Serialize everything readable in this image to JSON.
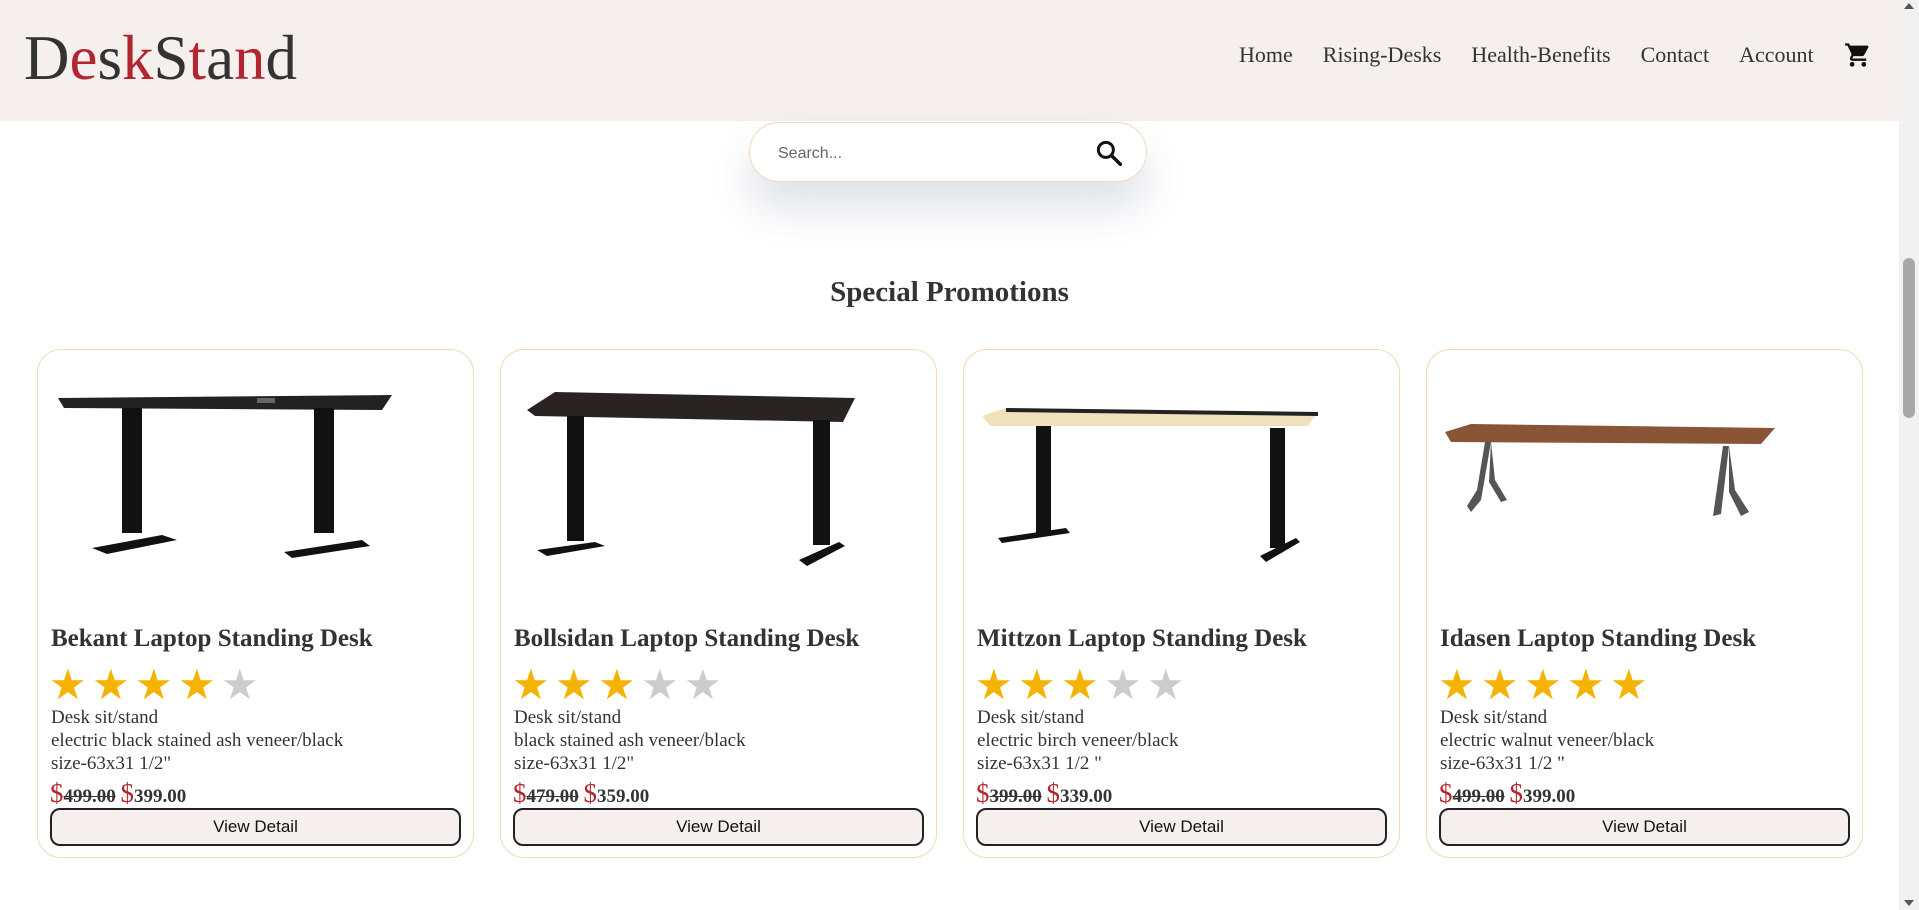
{
  "brand": {
    "letters": [
      "D",
      "e",
      "s",
      "k",
      "S",
      "t",
      "a",
      "n",
      "d"
    ],
    "colors": [
      "#333333",
      "#b3262f",
      "#333333",
      "#b3262f",
      "#333333",
      "#b3262f",
      "#333333",
      "#b3262f",
      "#333333"
    ]
  },
  "nav": {
    "items": [
      "Home",
      "Rising-Desks",
      "Health-Benefits",
      "Contact",
      "Account"
    ],
    "cart_icon": "cart-icon"
  },
  "search": {
    "placeholder": "Search...",
    "icon": "search-icon"
  },
  "section_title": "Special Promotions",
  "colors": {
    "header_bg": "#f5efee",
    "accent": "#b3262f",
    "star": "#f5b301",
    "star_off": "#cccccc",
    "card_border": "#f5d8b6"
  },
  "products": [
    {
      "title": "Bekant Laptop Standing Desk",
      "rating": 4,
      "desc": [
        "Desk sit/stand",
        "electric black stained ash veneer/black",
        "size-63x31 1/2\""
      ],
      "currency": "$",
      "old_price": "499.00",
      "new_price": "399.00",
      "button": "View Detail",
      "image": "black-standing-desk"
    },
    {
      "title": "Bollsidan Laptop Standing Desk",
      "rating": 3,
      "desc": [
        "Desk sit/stand",
        "black stained ash veneer/black",
        "size-63x31 1/2\""
      ],
      "currency": "$",
      "old_price": "479.00",
      "new_price": "359.00",
      "button": "View Detail",
      "image": "dark-brown-standing-desk"
    },
    {
      "title": "Mittzon Laptop Standing Desk",
      "rating": 3,
      "desc": [
        "Desk sit/stand",
        "electric birch veneer/black",
        "size-63x31 1/2 \""
      ],
      "currency": "$",
      "old_price": "399.00",
      "new_price": "339.00",
      "button": "View Detail",
      "image": "birch-standing-desk"
    },
    {
      "title": "Idasen Laptop Standing Desk",
      "rating": 5,
      "desc": [
        "Desk sit/stand",
        "electric walnut veneer/black",
        "size-63x31 1/2 \""
      ],
      "currency": "$",
      "old_price": "499.00",
      "new_price": "399.00",
      "button": "View Detail",
      "image": "walnut-desk"
    }
  ]
}
